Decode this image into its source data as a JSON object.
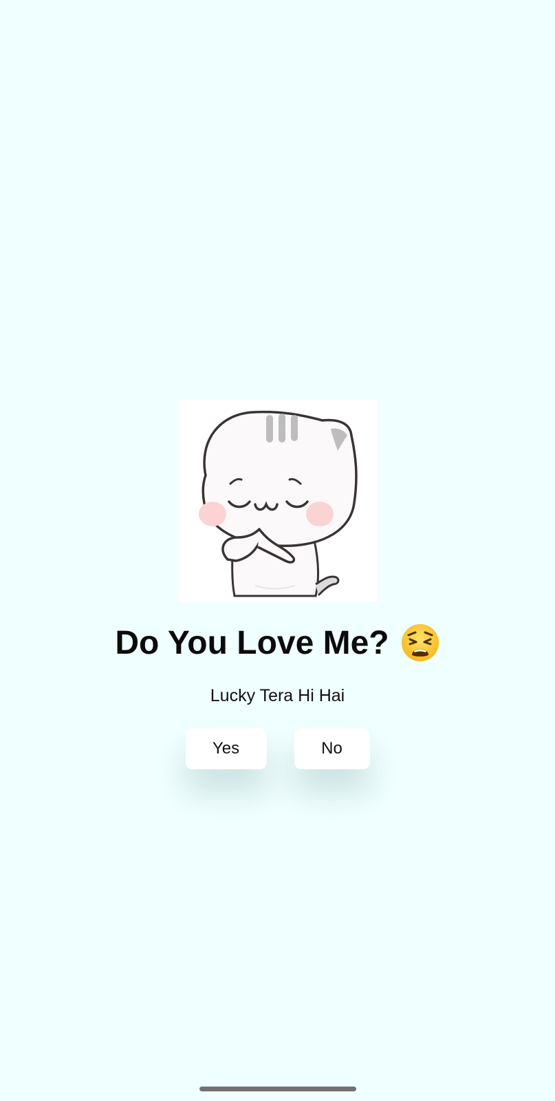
{
  "screen": {
    "background_color": "#F0FFFF"
  },
  "sticker": {
    "icon": "praying-cat-sticker"
  },
  "question": {
    "title": "Do You Love Me?",
    "emoji": "weary-face-emoji"
  },
  "subtitle": "Lucky Tera Hi Hai",
  "buttons": {
    "yes_label": "Yes",
    "no_label": "No"
  },
  "system": {
    "home_indicator": "home-indicator-bar"
  }
}
